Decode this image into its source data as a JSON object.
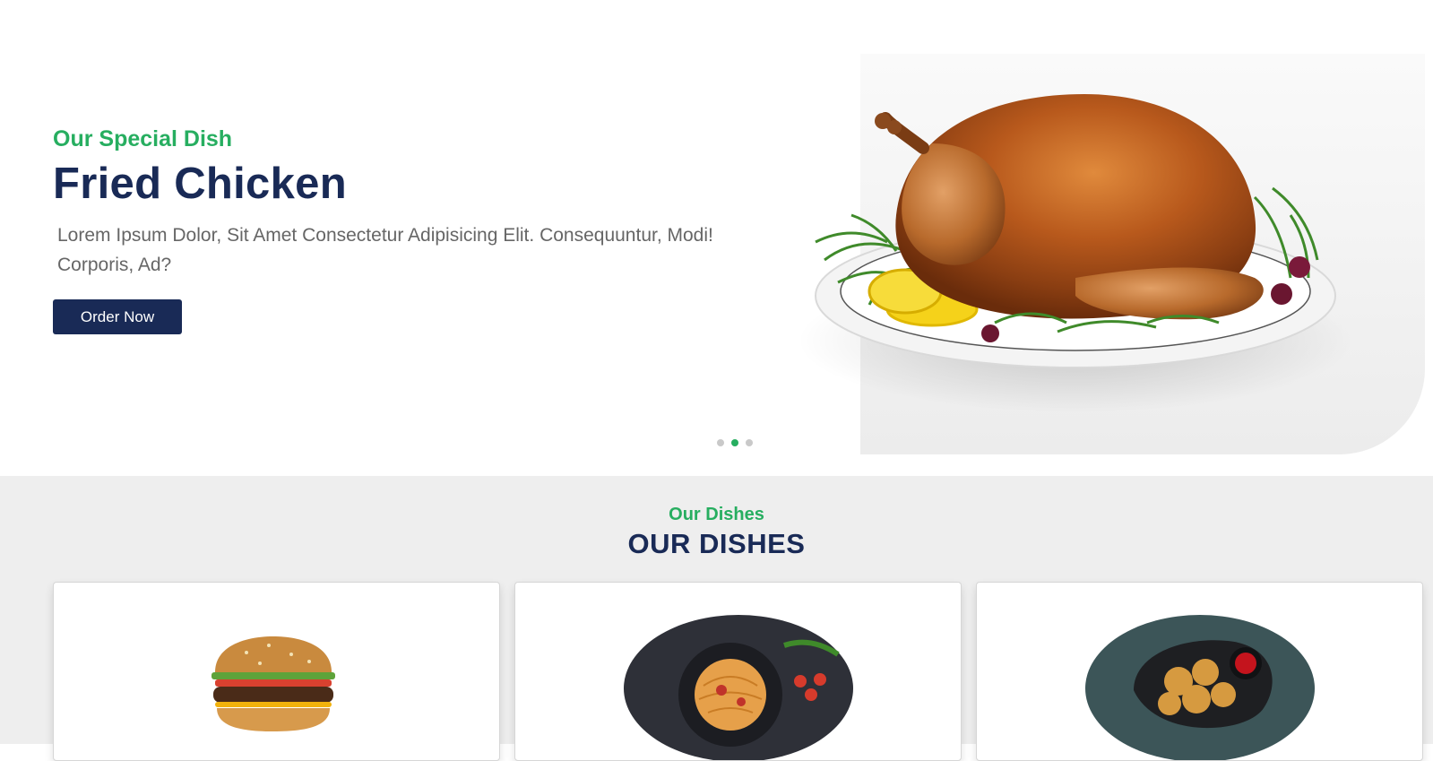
{
  "hero": {
    "subtitle": "Our Special Dish",
    "title": "Fried Chicken",
    "description": "Lorem Ipsum Dolor, Sit Amet Consectetur Adipisicing Elit. Consequuntur, Modi! Corporis, Ad?",
    "button_label": "Order Now",
    "image_icon": "roast-chicken-platter",
    "slider": {
      "total": 3,
      "active_index": 2
    }
  },
  "dishes": {
    "subtitle": "Our Dishes",
    "title": "OUR DISHES",
    "cards": [
      {
        "image_icon": "burger-image"
      },
      {
        "image_icon": "spaghetti-plate-image"
      },
      {
        "image_icon": "chicken-nuggets-plate-image"
      }
    ]
  },
  "colors": {
    "accent_green": "#27ae60",
    "navy": "#192a56",
    "text_gray": "#666666",
    "section_bg": "#eeeeee"
  }
}
